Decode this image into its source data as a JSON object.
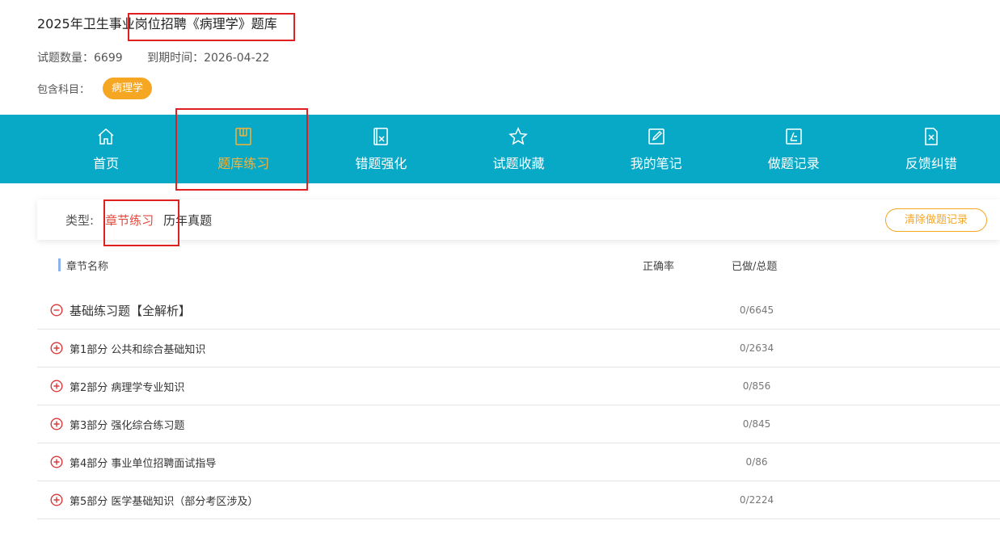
{
  "header": {
    "title": "2025年卫生事业岗位招聘《病理学》题库",
    "question_count_label": "试题数量：",
    "question_count": "6699",
    "expiry_label": "到期时间：",
    "expiry_date": "2026-04-22",
    "subjects_label": "包含科目：",
    "subject_tag": "病理学"
  },
  "nav": {
    "items": [
      {
        "label": "首页",
        "icon": "home-icon"
      },
      {
        "label": "题库练习",
        "icon": "book-icon"
      },
      {
        "label": "错题强化",
        "icon": "wrong-question-icon"
      },
      {
        "label": "试题收藏",
        "icon": "star-icon"
      },
      {
        "label": "我的笔记",
        "icon": "edit-note-icon"
      },
      {
        "label": "做题记录",
        "icon": "record-icon"
      },
      {
        "label": "反馈纠错",
        "icon": "feedback-icon"
      }
    ],
    "active_index": 1,
    "background": "#07a9c6",
    "active_color": "#f6b339"
  },
  "filter": {
    "label": "类型:",
    "options": [
      "章节练习",
      "历年真题"
    ],
    "active": "章节练习",
    "clear_button": "清除做题记录"
  },
  "table": {
    "headers": {
      "name": "章节名称",
      "accuracy": "正确率",
      "progress": "已做/总题"
    },
    "rows": [
      {
        "name": "基础练习题【全解析】",
        "count": "0/6645",
        "expanded": true
      },
      {
        "name": "第1部分 公共和综合基础知识",
        "count": "0/2634",
        "expanded": false
      },
      {
        "name": "第2部分 病理学专业知识",
        "count": "0/856",
        "expanded": false
      },
      {
        "name": "第3部分 强化综合练习题",
        "count": "0/845",
        "expanded": false
      },
      {
        "name": "第4部分 事业单位招聘面试指导",
        "count": "0/86",
        "expanded": false
      },
      {
        "name": "第5部分 医学基础知识（部分考区涉及）",
        "count": "0/2224",
        "expanded": false
      }
    ]
  },
  "colors": {
    "accent_red": "#e5473b",
    "tag_orange": "#f5a623",
    "toggle_red": "#d9383a"
  }
}
